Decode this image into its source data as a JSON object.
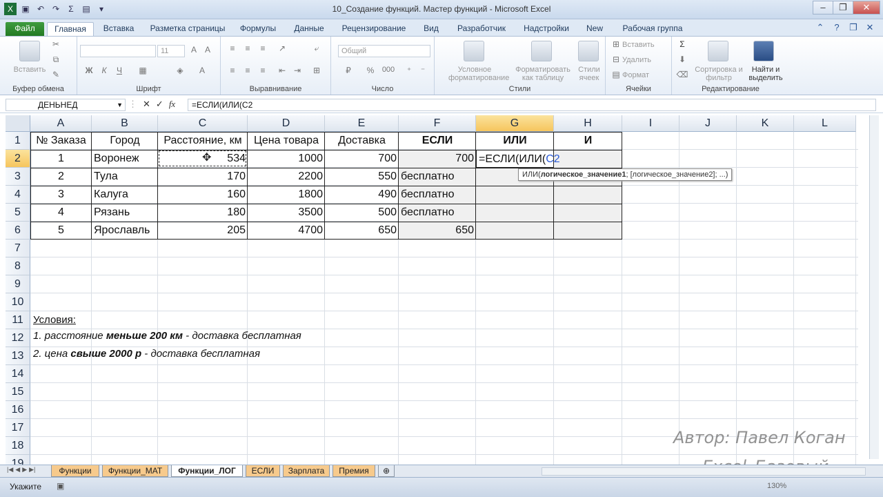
{
  "window": {
    "title": "10_Создание функций. Мастер функций  -  Microsoft Excel"
  },
  "qat_icons": [
    "excel-icon",
    "save-icon",
    "undo-icon",
    "redo-icon",
    "sum-icon",
    "print-icon"
  ],
  "ribbon_tabs": [
    "Файл",
    "Главная",
    "Вставка",
    "Разметка страницы",
    "Формулы",
    "Данные",
    "Рецензирование",
    "Вид",
    "Разработчик",
    "Надстройки",
    "New",
    "Рабочая группа"
  ],
  "ribbon": {
    "clipboard": {
      "label": "Буфер обмена",
      "paste": "Вставить"
    },
    "font": {
      "label": "Шрифт",
      "size": "11",
      "bold": "Ж",
      "italic": "К",
      "underline": "Ч"
    },
    "alignment": {
      "label": "Выравнивание"
    },
    "number": {
      "label": "Число",
      "format": "Общий",
      "percent": "%",
      "thousands": "000"
    },
    "styles": {
      "label": "Стили",
      "conditional": "Условное форматирование",
      "as_table": "Форматировать как таблицу",
      "cell_styles": "Стили ячеек"
    },
    "cells": {
      "label": "Ячейки",
      "insert": "Вставить",
      "delete": "Удалить",
      "format": "Формат"
    },
    "editing": {
      "label": "Редактирование",
      "sort": "Сортировка и фильтр",
      "find": "Найти и выделить"
    }
  },
  "formula_bar": {
    "name_box": "ДЕНЬНЕД",
    "formula": "=ЕСЛИ(ИЛИ(С2",
    "fx": "fx"
  },
  "columns": [
    "A",
    "B",
    "C",
    "D",
    "E",
    "F",
    "G",
    "H",
    "I",
    "J",
    "K",
    "L"
  ],
  "rows": [
    "1",
    "2",
    "3",
    "4",
    "5",
    "6",
    "7",
    "8",
    "9",
    "10",
    "11",
    "12",
    "13",
    "14",
    "15",
    "16",
    "17",
    "18",
    "19"
  ],
  "table": {
    "headers": [
      "№ Заказа",
      "Город",
      "Расстояние, км",
      "Цена товара",
      "Доставка",
      "ЕСЛИ",
      "ИЛИ",
      "И"
    ],
    "rows": [
      [
        "1",
        "Воронеж",
        "534",
        "1000",
        "700",
        "700",
        "=ЕСЛИ(ИЛИ(С2",
        ""
      ],
      [
        "2",
        "Тула",
        "170",
        "2200",
        "550",
        "бесплатно",
        "",
        ""
      ],
      [
        "3",
        "Калуга",
        "160",
        "1800",
        "490",
        "бесплатно",
        "",
        ""
      ],
      [
        "4",
        "Рязань",
        "180",
        "3500",
        "500",
        "бесплатно",
        "",
        ""
      ],
      [
        "5",
        "Ярославль",
        "205",
        "4700",
        "650",
        "650",
        "",
        ""
      ]
    ]
  },
  "edit_cell": {
    "prefix": "=ЕСЛИ(ИЛИ(",
    "ref": "С2"
  },
  "tooltip": {
    "fn": "ИЛИ(",
    "arg1": "логическое_значение1",
    "rest": "; [логическое_значение2]; ...)"
  },
  "conditions": {
    "title": "Условия:",
    "line1_a": "1. расстояние ",
    "line1_b": "меньше 200 км",
    "line1_c": "  - доставка бесплатная",
    "line2_a": "2. цена ",
    "line2_b": "свыше 2000 р",
    "line2_c": "  - доставка бесплатная"
  },
  "sheets": [
    "Функции",
    "Функции_МАТ",
    "Функции_ЛОГ",
    "ЕСЛИ",
    "Зарплата",
    "Премия"
  ],
  "active_sheet": "Функции_ЛОГ",
  "status": {
    "mode": "Укажите",
    "zoom": "130%"
  },
  "watermark": {
    "line1": "Автор: Павел Коган",
    "line2": "Excel_Базовый"
  },
  "colors": {
    "file_tab": "#2e8b2e",
    "sheet_tab": "#f7ca8c",
    "selected_header": "#f6c55d",
    "ref_blue": "#2a5bd7"
  }
}
